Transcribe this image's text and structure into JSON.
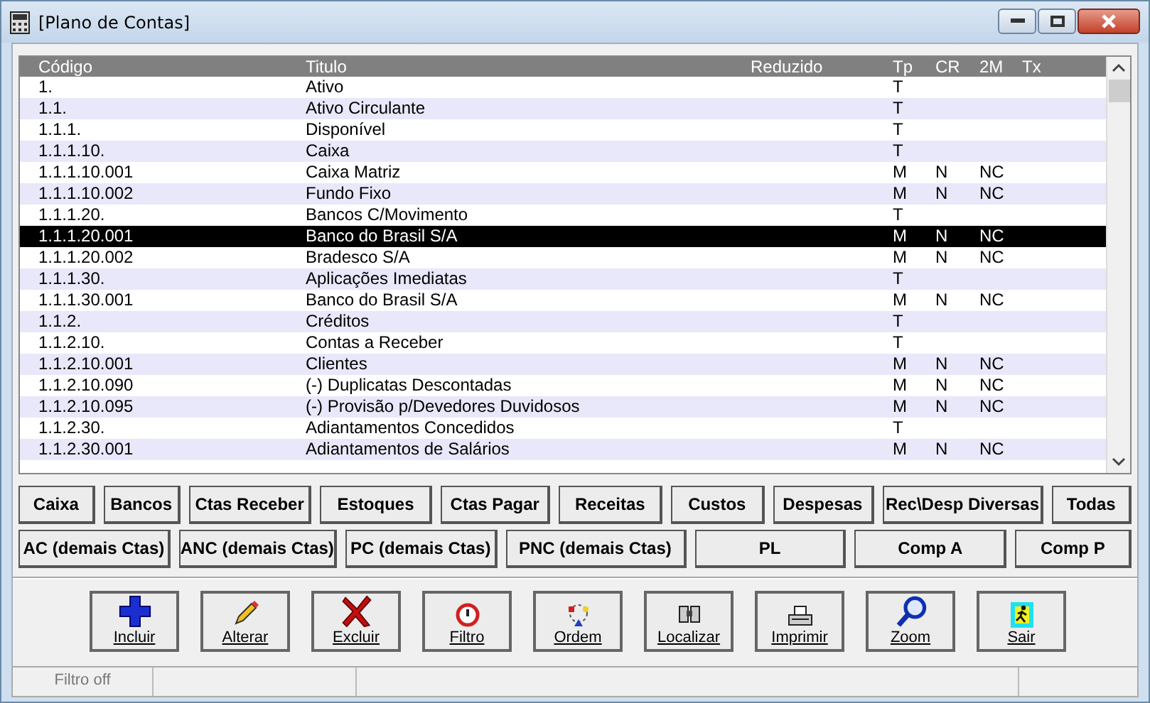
{
  "window": {
    "title": "[Plano de Contas]"
  },
  "table": {
    "columns": [
      "Código",
      "Titulo",
      "Reduzido",
      "Tp",
      "CR",
      "2M",
      "Tx"
    ],
    "rows": [
      {
        "cells": [
          "1.",
          "Ativo",
          "",
          "T",
          "",
          "",
          ""
        ],
        "selected": false
      },
      {
        "cells": [
          "1.1.",
          "Ativo Circulante",
          "",
          "T",
          "",
          "",
          ""
        ],
        "selected": false
      },
      {
        "cells": [
          "1.1.1.",
          "Disponível",
          "",
          "T",
          "",
          "",
          ""
        ],
        "selected": false
      },
      {
        "cells": [
          "1.1.1.10.",
          "Caixa",
          "",
          "T",
          "",
          "",
          ""
        ],
        "selected": false
      },
      {
        "cells": [
          "1.1.1.10.001",
          "Caixa Matriz",
          "",
          "M",
          "N",
          "NC",
          ""
        ],
        "selected": false
      },
      {
        "cells": [
          "1.1.1.10.002",
          "Fundo Fixo",
          "",
          "M",
          "N",
          "NC",
          ""
        ],
        "selected": false
      },
      {
        "cells": [
          "1.1.1.20.",
          "Bancos C/Movimento",
          "",
          "T",
          "",
          "",
          ""
        ],
        "selected": false
      },
      {
        "cells": [
          "1.1.1.20.001",
          "Banco do Brasil S/A",
          "",
          "M",
          "N",
          "NC",
          ""
        ],
        "selected": true
      },
      {
        "cells": [
          "1.1.1.20.002",
          "Bradesco S/A",
          "",
          "M",
          "N",
          "NC",
          ""
        ],
        "selected": false
      },
      {
        "cells": [
          "1.1.1.30.",
          "Aplicações Imediatas",
          "",
          "T",
          "",
          "",
          ""
        ],
        "selected": false
      },
      {
        "cells": [
          "1.1.1.30.001",
          "Banco do Brasil S/A",
          "",
          "M",
          "N",
          "NC",
          ""
        ],
        "selected": false
      },
      {
        "cells": [
          "1.1.2.",
          "Créditos",
          "",
          "T",
          "",
          "",
          ""
        ],
        "selected": false
      },
      {
        "cells": [
          "1.1.2.10.",
          "Contas a Receber",
          "",
          "T",
          "",
          "",
          ""
        ],
        "selected": false
      },
      {
        "cells": [
          "1.1.2.10.001",
          "Clientes",
          "",
          "M",
          "N",
          "NC",
          ""
        ],
        "selected": false
      },
      {
        "cells": [
          "1.1.2.10.090",
          "(-) Duplicatas Descontadas",
          "",
          "M",
          "N",
          "NC",
          ""
        ],
        "selected": false
      },
      {
        "cells": [
          "1.1.2.10.095",
          "(-) Provisão p/Devedores Duvidosos",
          "",
          "M",
          "N",
          "NC",
          ""
        ],
        "selected": false
      },
      {
        "cells": [
          "1.1.2.30.",
          "Adiantamentos Concedidos",
          "",
          "T",
          "",
          "",
          ""
        ],
        "selected": false
      },
      {
        "cells": [
          "1.1.2.30.001",
          "Adiantamentos de Salários",
          "",
          "M",
          "N",
          "NC",
          ""
        ],
        "selected": false
      }
    ]
  },
  "filter_buttons_row1": [
    "Caixa",
    "Bancos",
    "Ctas Receber",
    "Estoques",
    "Ctas Pagar",
    "Receitas",
    "Custos",
    "Despesas",
    "Rec\\Desp Diversas",
    "Todas"
  ],
  "filter_buttons_row2": [
    "AC (demais Ctas)",
    "ANC (demais Ctas)",
    "PC (demais Ctas)",
    "PNC (demais Ctas)",
    "PL",
    "Comp A",
    "Comp P"
  ],
  "toolbar": [
    {
      "kind": "plus",
      "label": "Incluir"
    },
    {
      "kind": "pencil",
      "label": "Alterar"
    },
    {
      "kind": "cross",
      "label": "Excluir"
    },
    {
      "kind": "filter",
      "label": "Filtro"
    },
    {
      "kind": "order",
      "label": "Ordem"
    },
    {
      "kind": "find",
      "label": "Localizar"
    },
    {
      "kind": "print",
      "label": "Imprimir"
    },
    {
      "kind": "zoom",
      "label": "Zoom"
    },
    {
      "kind": "exit",
      "label": "Sair"
    }
  ],
  "status_bar": [
    "Filtro off"
  ]
}
